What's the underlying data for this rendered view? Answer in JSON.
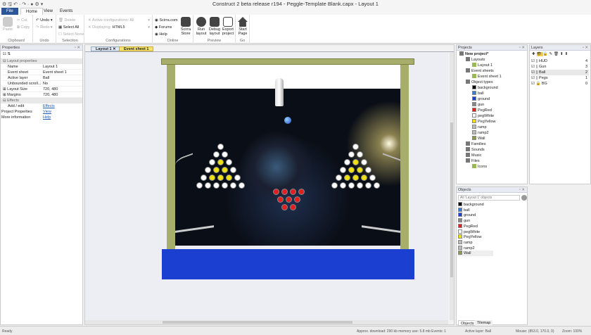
{
  "title": "Construct 2 beta release r194 - Peggle-Template Blank.capx - Layout 1",
  "ribbon_tabs": [
    "File",
    "Home",
    "View",
    "Events"
  ],
  "ribbon": {
    "clipboard": {
      "paste": "Paste",
      "cut": "Cut",
      "copy": "Copy",
      "label": "Clipboard"
    },
    "undo": {
      "undo": "Undo",
      "redo": "Redo",
      "label": "Undo"
    },
    "selection": {
      "delete": "Delete",
      "select_all": "Select All",
      "select_none": "Select None",
      "label": "Selection"
    },
    "configurations": {
      "active": "Active configurations: All",
      "displaying": "Displaying:",
      "displaying_value": "HTML5",
      "label": "Configurations"
    },
    "online": {
      "scirra": "Scirra.com",
      "forums": "Forums",
      "help": "Help",
      "store": "Scirra Store",
      "label": "Online"
    },
    "preview": {
      "run": "Run layout",
      "debug": "Debug layout",
      "export": "Export project",
      "label": "Preview"
    },
    "go": {
      "start": "Start Page",
      "label": "Go"
    }
  },
  "properties": {
    "title": "Properties",
    "section1": "Layout properties",
    "rows": [
      [
        "Name",
        "Layout 1"
      ],
      [
        "Event sheet",
        "Event sheet 1"
      ],
      [
        "Active layer",
        "Ball"
      ],
      [
        "Unbounded scroll...",
        "No"
      ],
      [
        "Layout Size",
        "720, 480"
      ],
      [
        "Margins",
        "720, 480"
      ]
    ],
    "section2": "Effects",
    "addedit": "Add / edit",
    "effects": "Effects",
    "project_props": "Project Properties",
    "view": "View",
    "more_info": "More information",
    "help": "Help"
  },
  "editor_tabs": [
    "Layout 1",
    "Event sheet 1"
  ],
  "projects": {
    "title": "Projects",
    "tree": [
      {
        "label": "New project*",
        "level": 0,
        "bold": true
      },
      {
        "label": "Layouts",
        "level": 1
      },
      {
        "label": "Layout 1",
        "level": 2
      },
      {
        "label": "Event sheets",
        "level": 1
      },
      {
        "label": "Event sheet 1",
        "level": 2
      },
      {
        "label": "Object types",
        "level": 1
      },
      {
        "label": "background",
        "level": 2,
        "color": "#000000"
      },
      {
        "label": "ball",
        "level": 2,
        "color": "#3a7bd5"
      },
      {
        "label": "ground",
        "level": 2,
        "color": "#1b3fd0"
      },
      {
        "label": "gun",
        "level": 2,
        "color": "#888888"
      },
      {
        "label": "PegRed",
        "level": 2,
        "color": "#e02020"
      },
      {
        "label": "pegWhite",
        "level": 2,
        "color": "#ffffff"
      },
      {
        "label": "PegYellow",
        "level": 2,
        "color": "#f0e010"
      },
      {
        "label": "ramp",
        "level": 2,
        "color": "#bbbbbb"
      },
      {
        "label": "ramp2",
        "level": 2,
        "color": "#bbbbbb"
      },
      {
        "label": "Wall",
        "level": 2,
        "color": "#8c9a4a"
      },
      {
        "label": "Families",
        "level": 1
      },
      {
        "label": "Sounds",
        "level": 1
      },
      {
        "label": "Music",
        "level": 1
      },
      {
        "label": "Files",
        "level": 1
      },
      {
        "label": "Icons",
        "level": 2
      }
    ]
  },
  "layers": {
    "title": "Layers",
    "items": [
      {
        "name": "HUD",
        "n": "4"
      },
      {
        "name": "Gun",
        "n": "3"
      },
      {
        "name": "Ball",
        "n": "2"
      },
      {
        "name": "Pegs",
        "n": "1"
      },
      {
        "name": "BG",
        "n": "0"
      }
    ]
  },
  "objects": {
    "title": "Objects",
    "filter_placeholder": "All 'Layout 1' objects",
    "items": [
      {
        "label": "background",
        "color": "#000000"
      },
      {
        "label": "ball",
        "color": "#3a7bd5"
      },
      {
        "label": "ground",
        "color": "#1b3fd0"
      },
      {
        "label": "gun",
        "color": "#888888"
      },
      {
        "label": "PegRed",
        "color": "#e02020"
      },
      {
        "label": "pegWhite",
        "color": "#ffffff"
      },
      {
        "label": "PegYellow",
        "color": "#f0e010"
      },
      {
        "label": "ramp",
        "color": "#bbbbbb"
      },
      {
        "label": "ramp2",
        "color": "#bbbbbb"
      },
      {
        "label": "Wall",
        "color": "#8c9a4a"
      }
    ],
    "tabs": [
      "Objects",
      "Tilemap"
    ]
  },
  "status": {
    "left": "Ready",
    "download": "Approx. download: 290 kb  memory use: 5.8 mb  Events: 1",
    "layer": "Active layer: Ball",
    "mouse": "Mouse: (853.0, 170.0, 0)",
    "zoom": "Zoom: 100%"
  }
}
